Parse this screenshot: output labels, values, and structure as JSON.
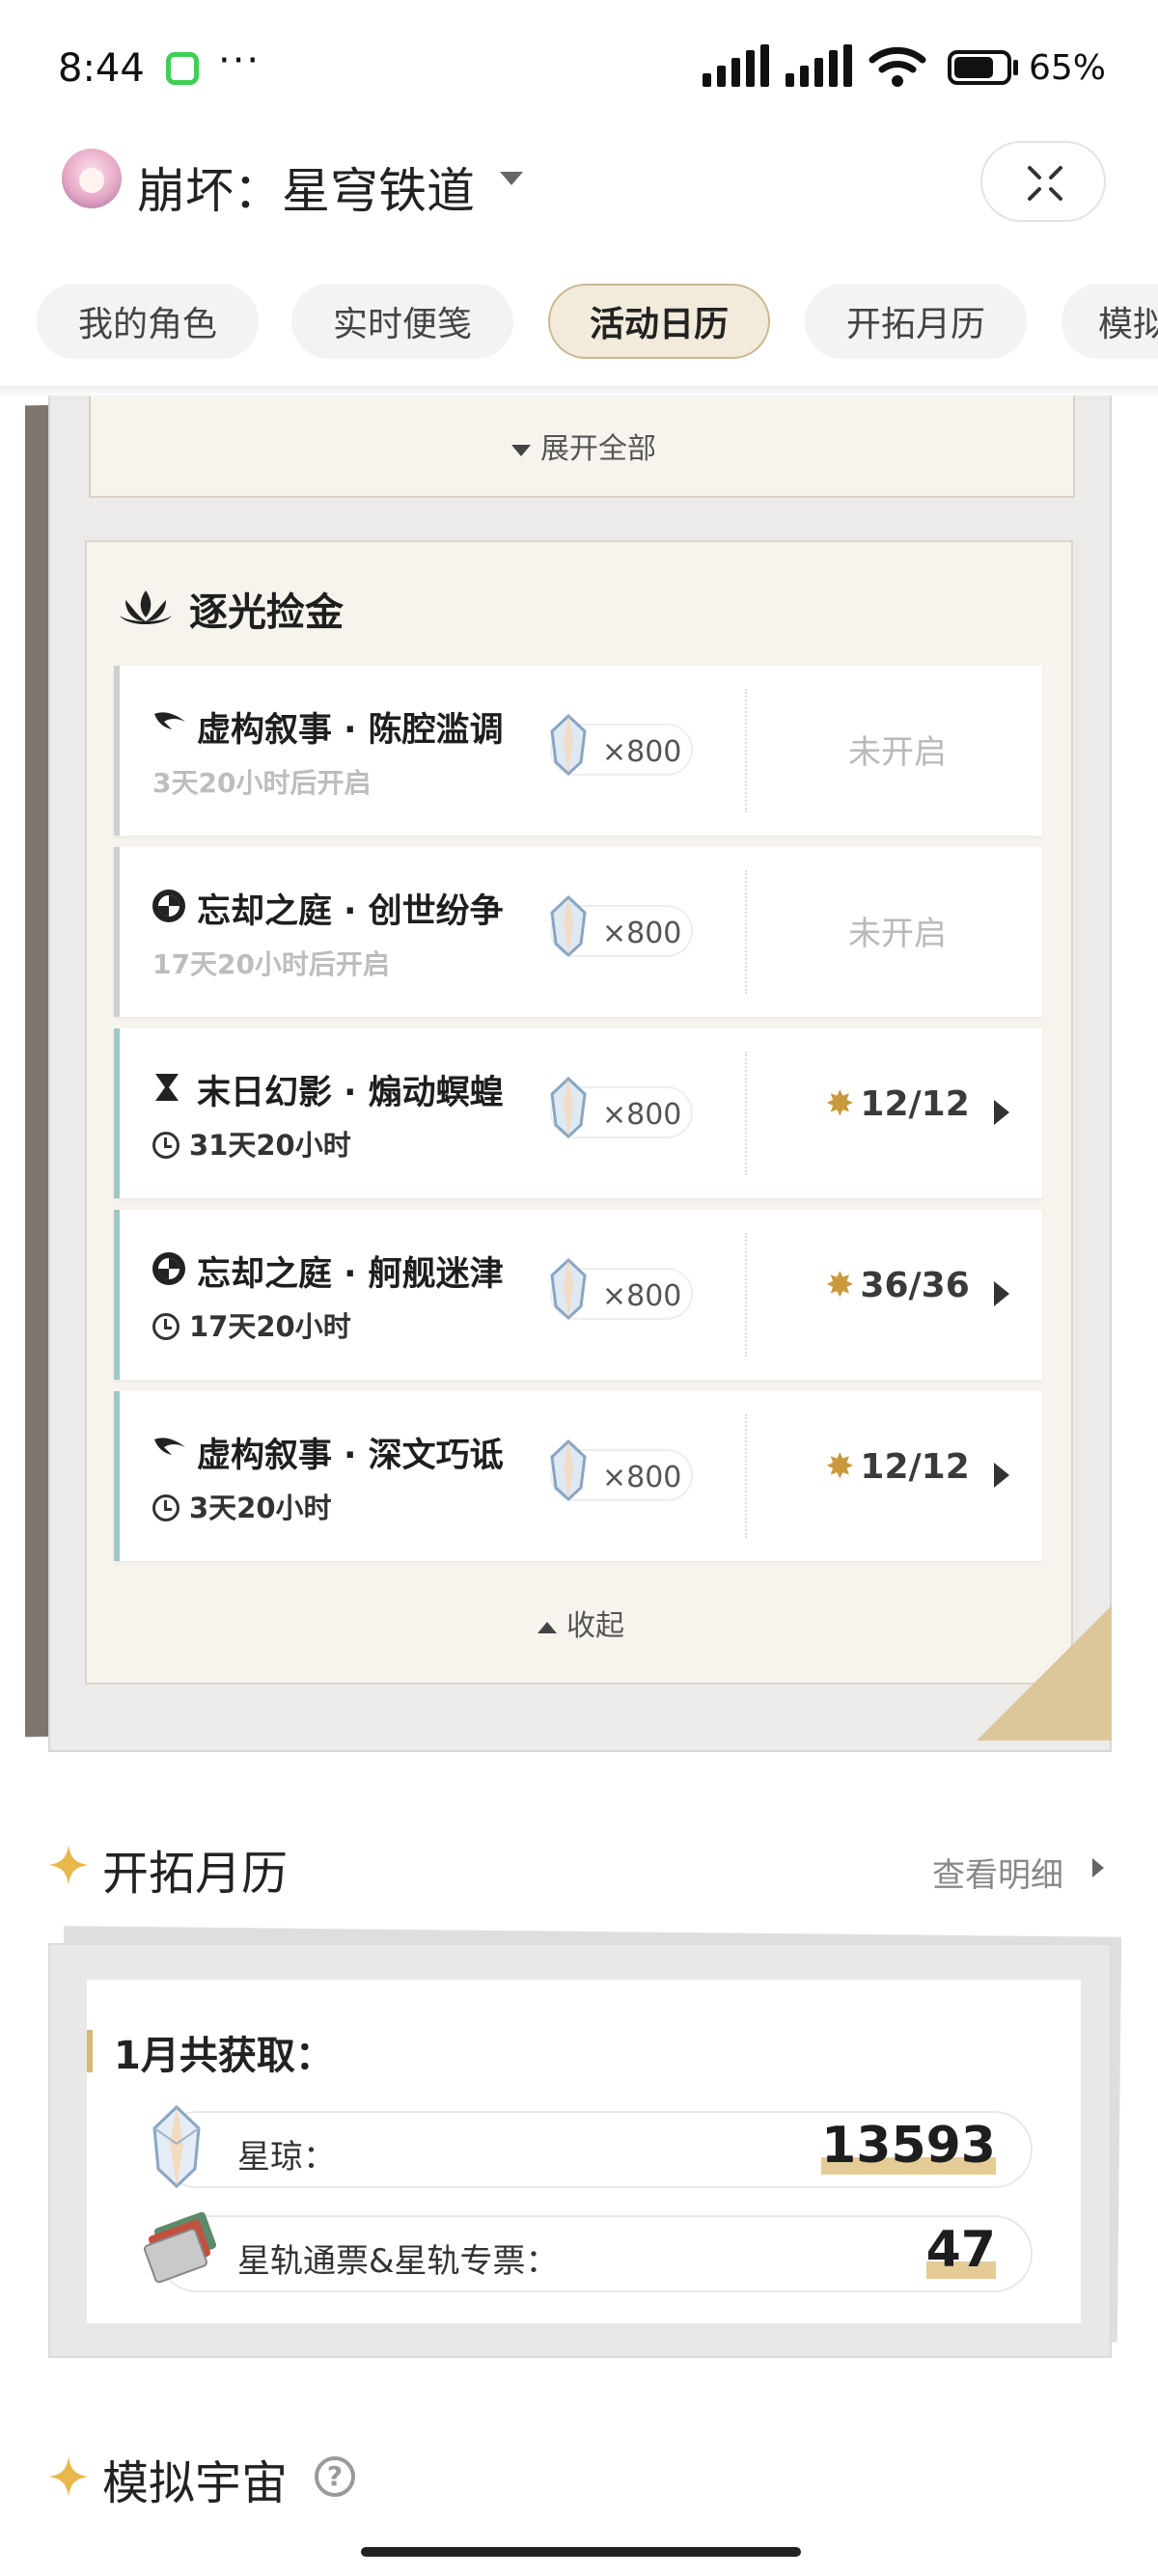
{
  "status_bar": {
    "time": "8:44",
    "more": "···",
    "battery": "65%"
  },
  "header": {
    "title": "崩坏：星穹铁道"
  },
  "tabs": [
    {
      "label": "我的角色"
    },
    {
      "label": "实时便笺"
    },
    {
      "label": "活动日历",
      "active": true
    },
    {
      "label": "开拓月历"
    },
    {
      "label": "模拟"
    }
  ],
  "events": {
    "expand_all": "展开全部",
    "collapse": "收起",
    "section_title": "逐光捡金",
    "rows": [
      {
        "name": "虚构叙事 · 陈腔滥调",
        "subtitle": "3天20小时后开启",
        "reward": "×800",
        "status": "未开启",
        "icon": "fiction-icon"
      },
      {
        "name": "忘却之庭 · 创世纷争",
        "subtitle": "17天20小时后开启",
        "reward": "×800",
        "status": "未开启",
        "icon": "forgotten-hall-icon"
      },
      {
        "name": "末日幻影 · 煽动螟蝗",
        "timer": "31天20小时",
        "reward": "×800",
        "progress": "12/12",
        "icon": "apocalyptic-icon"
      },
      {
        "name": "忘却之庭 · 舸舰迷津",
        "timer": "17天20小时",
        "reward": "×800",
        "progress": "36/36",
        "icon": "forgotten-hall-icon"
      },
      {
        "name": "虚构叙事 · 深文巧诋",
        "timer": "3天20小时",
        "reward": "×800",
        "progress": "12/12",
        "icon": "fiction-icon"
      }
    ]
  },
  "trailblaze": {
    "title": "开拓月历",
    "view_detail": "查看明细",
    "month_heading": "1月共获取：",
    "stellar_jade_label": "星琼：",
    "stellar_jade_value": "13593",
    "passes_label": "星轨通票&星轨专票：",
    "passes_value": "47"
  },
  "simulated_universe": {
    "title": "模拟宇宙",
    "help": "?"
  },
  "colors": {
    "accent_gold": "#c99a3d",
    "open_row_bar": "#9cc9c6",
    "closed_row_bar": "#cfcfcf",
    "active_tab_bg": "#f2ebdc"
  }
}
